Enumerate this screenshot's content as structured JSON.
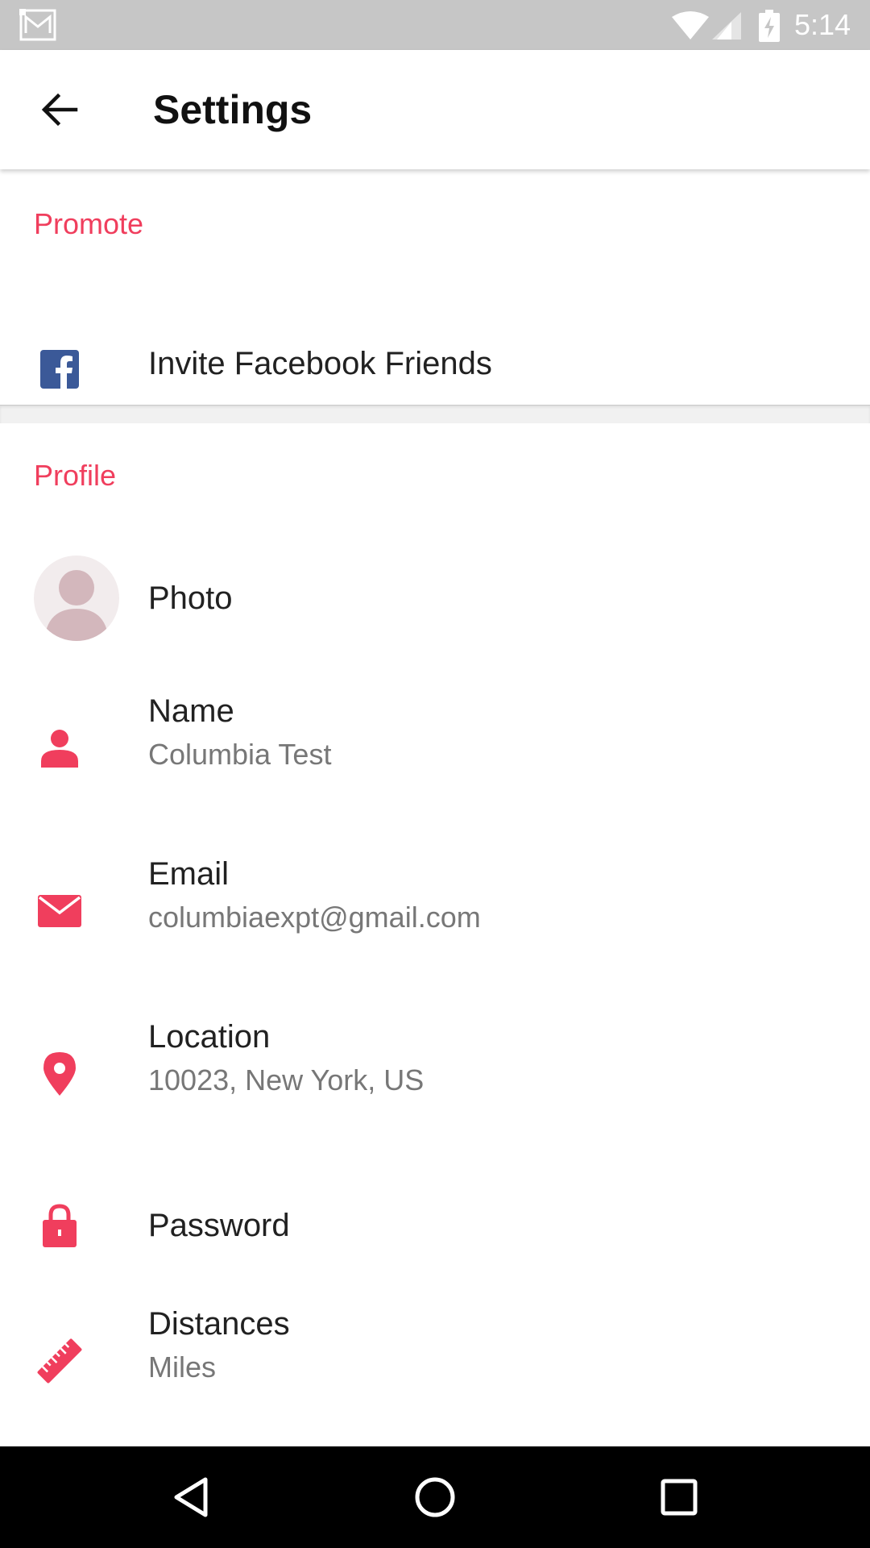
{
  "status_bar": {
    "time": "5:14",
    "icons": [
      "gmail-icon",
      "wifi-icon",
      "signal-icon",
      "battery-charging-icon"
    ]
  },
  "app_bar": {
    "title": "Settings",
    "back_icon": "arrow-back-icon"
  },
  "sections": {
    "promote": {
      "header": "Promote",
      "items": [
        {
          "label": "Invite Facebook Friends",
          "icon": "facebook-icon"
        }
      ]
    },
    "profile": {
      "header": "Profile",
      "items": [
        {
          "label": "Photo",
          "icon": "avatar-placeholder"
        },
        {
          "label": "Name",
          "value": "Columbia Test",
          "icon": "person-icon"
        },
        {
          "label": "Email",
          "value": "columbiaexpt@gmail.com",
          "icon": "envelope-icon"
        },
        {
          "label": "Location",
          "value": "10023, New York, US",
          "icon": "location-pin-icon"
        },
        {
          "label": "Password",
          "icon": "lock-icon"
        },
        {
          "label": "Distances",
          "value": "Miles",
          "icon": "ruler-icon"
        }
      ]
    }
  },
  "nav_bar": {
    "icons": [
      "back-triangle-icon",
      "home-circle-icon",
      "recents-square-icon"
    ]
  },
  "colors": {
    "accent": "#f03e5d",
    "facebook": "#3b5998",
    "status_bar": "#c6c6c6",
    "nav_bar": "#000000"
  }
}
